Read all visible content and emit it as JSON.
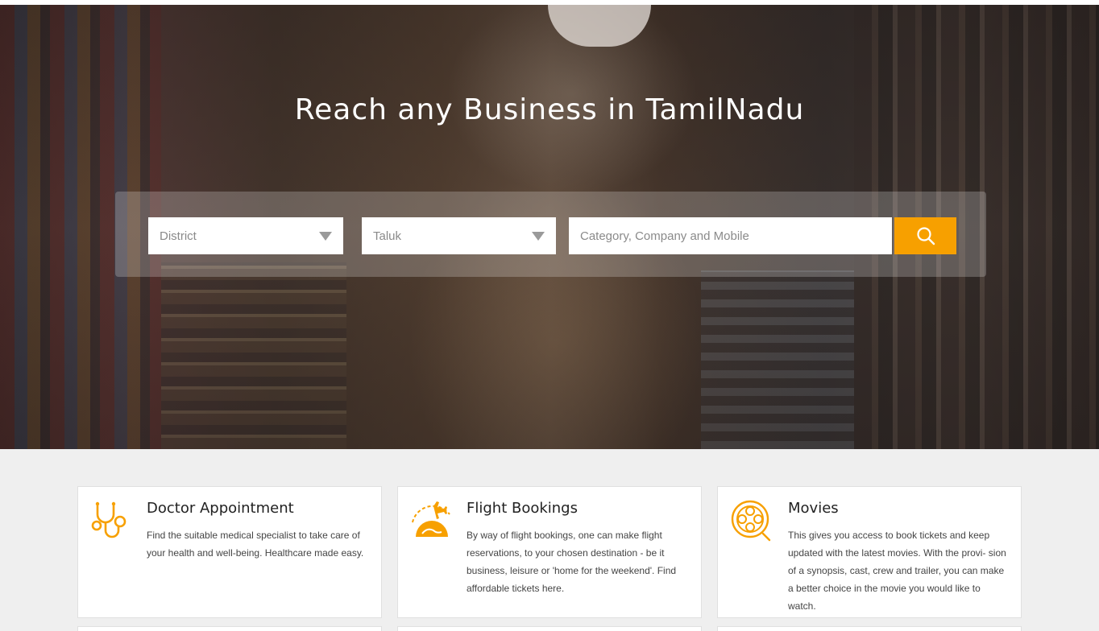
{
  "hero": {
    "title": "Reach any Business in TamilNadu"
  },
  "search": {
    "district_label": "District",
    "taluk_label": "Taluk",
    "query_placeholder": "Category, Company and Mobile",
    "accent_color": "#f7a000"
  },
  "services": [
    {
      "title": "Doctor Appointment",
      "description": "Find the suitable medical specialist to take care of your health and well-being. Healthcare made easy.",
      "icon": "stethoscope-icon"
    },
    {
      "title": "Flight Bookings",
      "description": "By way of flight bookings, one can make flight reservations, to your chosen destination - be it business, leisure or 'home for the weekend'. Find affordable tickets here.",
      "icon": "airplane-globe-icon"
    },
    {
      "title": "Movies",
      "description": "This gives you access to book tickets and keep updated with the latest movies. With the provi- sion of a synopsis, cast, crew and trailer, you can make a better choice in the movie you would like to watch.",
      "icon": "film-reel-icon"
    }
  ]
}
